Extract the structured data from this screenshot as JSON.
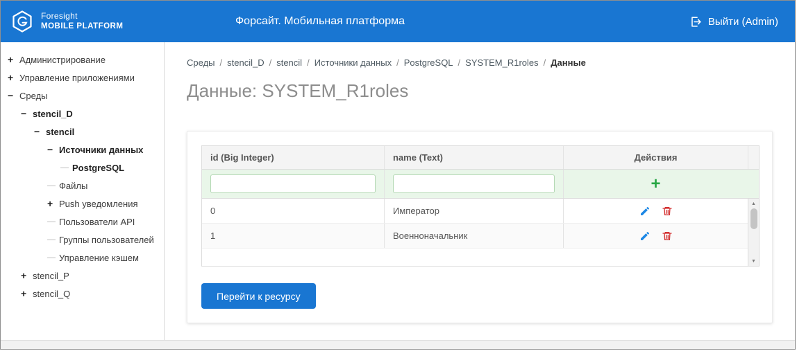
{
  "header": {
    "logo_title": "Foresight",
    "logo_subtitle": "MOBILE PLATFORM",
    "app_title": "Форсайт. Мобильная платформа",
    "logout_label": "Выйти (Admin)"
  },
  "sidebar": {
    "items": [
      {
        "label": "Администрирование",
        "toggle": "+"
      },
      {
        "label": "Управление приложениями",
        "toggle": "+"
      },
      {
        "label": "Среды",
        "toggle": "−"
      },
      {
        "label": "stencil_D",
        "toggle": "−"
      },
      {
        "label": "stencil",
        "toggle": "−"
      },
      {
        "label": "Источники данных",
        "toggle": "−"
      },
      {
        "label": "PostgreSQL",
        "toggle": ""
      },
      {
        "label": "Файлы",
        "toggle": ""
      },
      {
        "label": "Push уведомления",
        "toggle": "+"
      },
      {
        "label": "Пользователи API",
        "toggle": ""
      },
      {
        "label": "Группы пользователей",
        "toggle": ""
      },
      {
        "label": "Управление кэшем",
        "toggle": ""
      },
      {
        "label": "stencil_P",
        "toggle": "+"
      },
      {
        "label": "stencil_Q",
        "toggle": "+"
      }
    ]
  },
  "breadcrumb": {
    "separator": "/",
    "items": [
      "Среды",
      "stencil_D",
      "stencil",
      "Источники данных",
      "PostgreSQL",
      "SYSTEM_R1roles",
      "Данные"
    ]
  },
  "page": {
    "title": "Данные: SYSTEM_R1roles"
  },
  "table": {
    "columns": [
      "id (Big Integer)",
      "name (Text)",
      "Действия"
    ],
    "filter_inputs": [
      {
        "value": ""
      },
      {
        "value": ""
      }
    ],
    "rows": [
      {
        "id": "0",
        "name": "Император"
      },
      {
        "id": "1",
        "name": "Военноначальник"
      }
    ]
  },
  "actions": {
    "goto_resource": "Перейти к ресурсу"
  },
  "icons": {
    "add": "+",
    "scroll_up": "▲",
    "scroll_down": "▼"
  },
  "colors": {
    "header_bg": "#1976d2",
    "button_bg": "#1976d2",
    "add_green": "#28a745",
    "edit_blue": "#1e88e5",
    "delete_red": "#d32f2f",
    "filter_bg": "#e9f6e9"
  }
}
